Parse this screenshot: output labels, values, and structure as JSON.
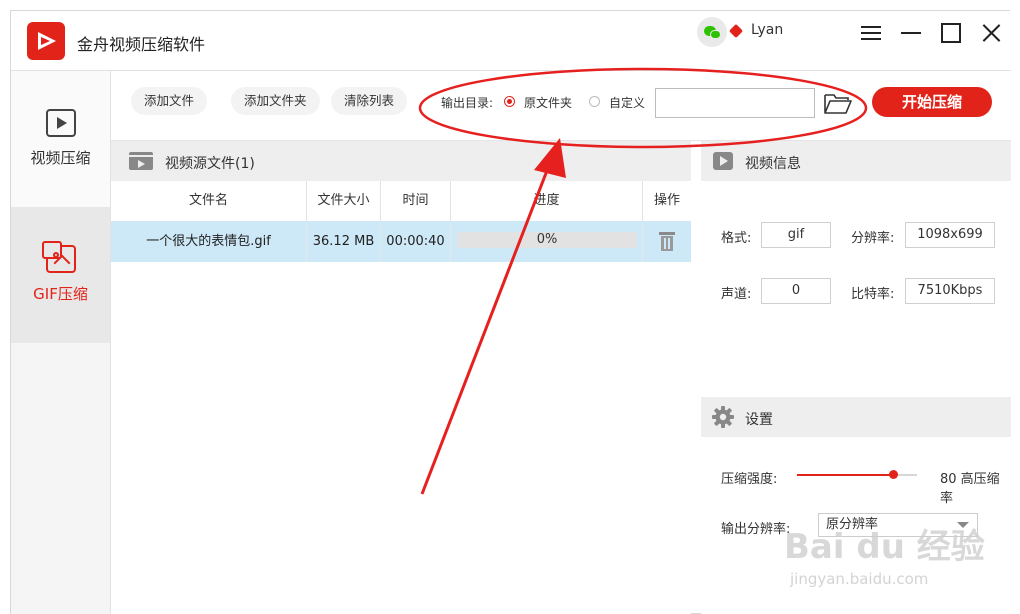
{
  "app": {
    "title": "金舟视频压缩软件",
    "username": "Lyan",
    "brand_color": "#e2231a"
  },
  "titlebar": {
    "icons": [
      "wechat-icon",
      "vip-icon",
      "menu-icon",
      "minimize-icon",
      "maximize-icon",
      "close-icon"
    ]
  },
  "sidebar": {
    "items": [
      {
        "label": "视频压缩",
        "icon": "video-play-icon",
        "selected": false
      },
      {
        "label": "GIF压缩",
        "icon": "gif-image-icon",
        "selected": true
      }
    ]
  },
  "toolbar": {
    "add_file": "添加文件",
    "add_folder": "添加文件夹",
    "clear_list": "清除列表",
    "output_label": "输出目录:",
    "option_original": "原文件夹",
    "option_custom": "自定义",
    "selected_option": "原文件夹",
    "path_value": "",
    "start": "开始压缩"
  },
  "file_list": {
    "title": "视频源文件(1)",
    "columns": [
      "文件名",
      "文件大小",
      "时间",
      "进度",
      "操作"
    ],
    "rows": [
      {
        "name": "一个很大的表情包.gif",
        "size": "36.12 MB",
        "time": "00:00:40",
        "progress_text": "0%",
        "progress": 0
      }
    ]
  },
  "video_info": {
    "title": "视频信息",
    "format_label": "格式:",
    "format_value": "gif",
    "resolution_label": "分辨率:",
    "resolution_value": "1098x699",
    "channel_label": "声道:",
    "channel_value": "0",
    "bitrate_label": "比特率:",
    "bitrate_value": "7510Kbps"
  },
  "settings": {
    "title": "设置",
    "strength_label": "压缩强度:",
    "strength_value": 80,
    "strength_text": "80 高压缩率",
    "output_res_label": "输出分辨率:",
    "output_res_value": "原分辨率"
  },
  "watermark": {
    "text": "Bai du 经验",
    "subtext": "jingyan.baidu.com"
  }
}
